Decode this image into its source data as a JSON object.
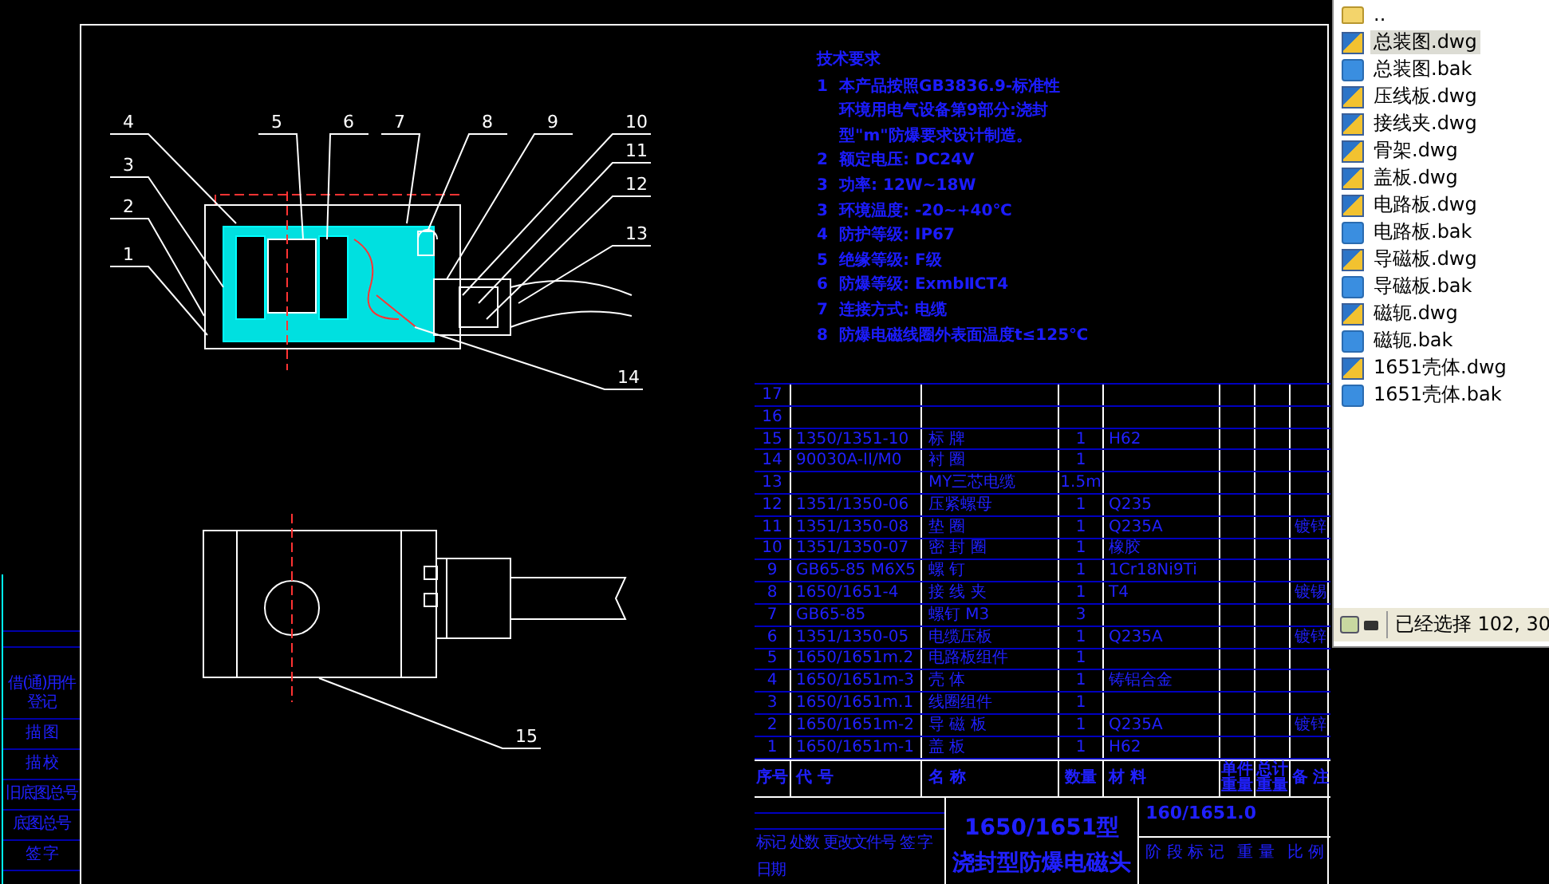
{
  "drawing": {
    "callouts": [
      "4",
      "5",
      "6",
      "7",
      "8",
      "9",
      "10",
      "3",
      "11",
      "12",
      "2",
      "13",
      "1",
      "14",
      "15"
    ]
  },
  "technical_requirements": {
    "title": "技术要求",
    "items": [
      {
        "number": "1",
        "lines": [
          "本产品按照GB3836.9-标准性",
          "环境用电气设备第9部分:浇封",
          "型\"m\"防爆要求设计制造。"
        ]
      },
      {
        "number": "2",
        "lines": [
          "额定电压: DC24V"
        ]
      },
      {
        "number": "3",
        "lines": [
          "功率: 12W~18W"
        ]
      },
      {
        "number": "3",
        "lines": [
          "环境温度: -20~+40℃"
        ]
      },
      {
        "number": "4",
        "lines": [
          "防护等级: IP67"
        ]
      },
      {
        "number": "5",
        "lines": [
          "绝缘等级: F级"
        ]
      },
      {
        "number": "6",
        "lines": [
          "防爆等级: ExmbⅡCT4"
        ]
      },
      {
        "number": "7",
        "lines": [
          "连接方式: 电缆"
        ]
      },
      {
        "number": "8",
        "lines": [
          "防爆电磁线圈外表面温度t≤125℃"
        ]
      }
    ]
  },
  "parts_table": {
    "columns": [
      "序号",
      "代 号",
      "名 称",
      "数量",
      "材 料",
      "单件重量",
      "总计重量",
      "备 注"
    ],
    "rows": [
      {
        "no": "17"
      },
      {
        "no": "16"
      },
      {
        "no": "15",
        "code": "1350/1351-10",
        "name": "标 牌",
        "qty": "1",
        "material": "H62"
      },
      {
        "no": "14",
        "code": "90030A-II/M0",
        "name": "衬 圈",
        "qty": "1"
      },
      {
        "no": "13",
        "name": "MY三芯电缆",
        "qty": "1.5m"
      },
      {
        "no": "12",
        "code": "1351/1350-06",
        "name": "压紧螺母",
        "qty": "1",
        "material": "Q235"
      },
      {
        "no": "11",
        "code": "1351/1350-08",
        "name": "垫 圈",
        "qty": "1",
        "material": "Q235A",
        "remark": "镀锌"
      },
      {
        "no": "10",
        "code": "1351/1350-07",
        "name": "密 封 圈",
        "qty": "1",
        "material": "橡胶"
      },
      {
        "no": "9",
        "code": "GB65-85 M6X5",
        "name": "螺 钉",
        "qty": "1",
        "material": "1Cr18Ni9Ti"
      },
      {
        "no": "8",
        "code": "1650/1651-4",
        "name": "接 线 夹",
        "qty": "1",
        "material": "T4",
        "remark": "镀锡"
      },
      {
        "no": "7",
        "code": "GB65-85",
        "name": "螺钉 M3",
        "qty": "3"
      },
      {
        "no": "6",
        "code": "1351/1350-05",
        "name": "电缆压板",
        "qty": "1",
        "material": "Q235A",
        "remark": "镀锌"
      },
      {
        "no": "5",
        "code": "1650/1651m.2",
        "name": "电路板组件",
        "qty": "1"
      },
      {
        "no": "4",
        "code": "1650/1651m-3",
        "name": "壳 体",
        "qty": "1",
        "material": "铸铝合金"
      },
      {
        "no": "3",
        "code": "1650/1651m.1",
        "name": "线圈组件",
        "qty": "1"
      },
      {
        "no": "2",
        "code": "1650/1651m-2",
        "name": "导 磁 板",
        "qty": "1",
        "material": "Q235A",
        "remark": "镀锌"
      },
      {
        "no": "1",
        "code": "1650/1651m-1",
        "name": "盖 板",
        "qty": "1",
        "material": "H62"
      }
    ]
  },
  "title_block": {
    "revision_labels": [
      "标记",
      "处数",
      "更改文件号",
      "签 字",
      "日期"
    ],
    "model": "1650/1651型",
    "product_name": "浇封型防爆电磁头",
    "drawing_number": "160/1651.0",
    "stage_label": "阶 段 标 记",
    "weight_label": "重 量",
    "scale_label": "比 例"
  },
  "margin_strip": {
    "labels": [
      "借(通)用件登记",
      "描 图",
      "描 校",
      "旧底图总号",
      "底图总号",
      "签 字"
    ]
  },
  "file_list": {
    "items": [
      {
        "name": "..",
        "kind": "folder",
        "selected": false
      },
      {
        "name": "总装图.dwg",
        "kind": "dwg",
        "selected": true
      },
      {
        "name": "总装图.bak",
        "kind": "bak",
        "selected": false
      },
      {
        "name": "压线板.dwg",
        "kind": "dwg",
        "selected": false
      },
      {
        "name": "接线夹.dwg",
        "kind": "dwg",
        "selected": false
      },
      {
        "name": "骨架.dwg",
        "kind": "dwg",
        "selected": false
      },
      {
        "name": "盖板.dwg",
        "kind": "dwg",
        "selected": false
      },
      {
        "name": "电路板.dwg",
        "kind": "dwg",
        "selected": false
      },
      {
        "name": "电路板.bak",
        "kind": "bak",
        "selected": false
      },
      {
        "name": "导磁板.dwg",
        "kind": "dwg",
        "selected": false
      },
      {
        "name": "导磁板.bak",
        "kind": "bak",
        "selected": false
      },
      {
        "name": "磁轭.dwg",
        "kind": "dwg",
        "selected": false
      },
      {
        "name": "磁轭.bak",
        "kind": "bak",
        "selected": false
      },
      {
        "name": "1651壳体.dwg",
        "kind": "dwg",
        "selected": false
      },
      {
        "name": "1651壳体.bak",
        "kind": "bak",
        "selected": false
      }
    ]
  },
  "status_bar": {
    "text": "已经选择 102, 30"
  }
}
